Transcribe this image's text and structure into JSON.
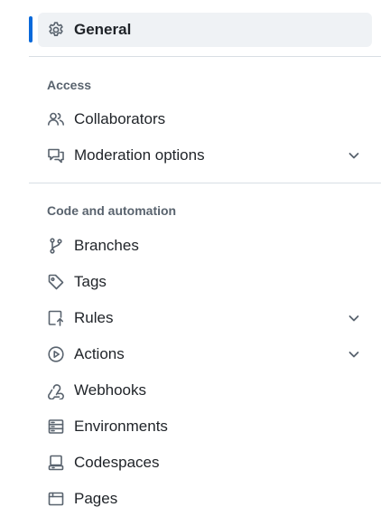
{
  "nav": {
    "general": {
      "label": "General",
      "icon": "gear-icon"
    },
    "sections": [
      {
        "heading": "Access",
        "items": [
          {
            "label": "Collaborators",
            "icon": "people-icon"
          },
          {
            "label": "Moderation options",
            "icon": "report-icon",
            "expandable": true
          }
        ]
      },
      {
        "heading": "Code and automation",
        "items": [
          {
            "label": "Branches",
            "icon": "git-branch-icon"
          },
          {
            "label": "Tags",
            "icon": "tag-icon"
          },
          {
            "label": "Rules",
            "icon": "repo-push-icon",
            "expandable": true
          },
          {
            "label": "Actions",
            "icon": "play-icon",
            "expandable": true
          },
          {
            "label": "Webhooks",
            "icon": "webhook-icon"
          },
          {
            "label": "Environments",
            "icon": "server-icon"
          },
          {
            "label": "Codespaces",
            "icon": "codespaces-icon"
          },
          {
            "label": "Pages",
            "icon": "browser-icon"
          }
        ]
      }
    ]
  },
  "colors": {
    "accent": "#0969da",
    "active_bg": "#eff2f5",
    "text": "#1f2328",
    "muted": "#59636e",
    "divider": "#d8dee4"
  }
}
